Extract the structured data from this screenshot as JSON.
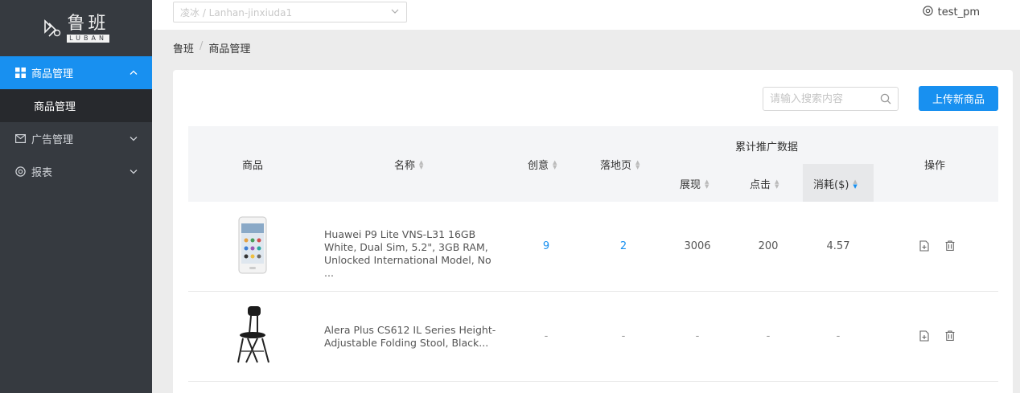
{
  "sidebar": {
    "logo_cn": "鲁班",
    "logo_en": "LUBAN",
    "menu": [
      {
        "label": "商品管理",
        "icon": "grid-icon",
        "expanded": true
      },
      {
        "label": "广告管理",
        "icon": "mail-icon",
        "expanded": false
      },
      {
        "label": "报表",
        "icon": "settings-icon",
        "expanded": false
      }
    ],
    "submenu": [
      {
        "label": "商品管理"
      }
    ]
  },
  "topbar": {
    "project_select": "凌冰 / Lanhan-jinxiuda1",
    "user": "test_pm"
  },
  "breadcrumb": [
    "鲁班",
    "商品管理"
  ],
  "toolbar": {
    "search_placeholder": "请输入搜索内容",
    "upload_label": "上传新商品"
  },
  "table": {
    "headers": {
      "product": "商品",
      "name": "名称",
      "creative": "创意",
      "landing": "落地页",
      "group": "累计推广数据",
      "impressions": "展现",
      "clicks": "点击",
      "cost": "消耗($)",
      "actions": "操作"
    },
    "rows": [
      {
        "image": "phone",
        "name": "Huawei P9 Lite VNS-L31 16GB White, Dual Sim, 5.2\", 3GB RAM, Unlocked International Model, No ...",
        "creative": "9",
        "landing": "2",
        "impressions": "3006",
        "clicks": "200",
        "cost": "4.57"
      },
      {
        "image": "stool",
        "name": "Alera Plus CS612 IL Series Height-Adjustable Folding Stool, Black...",
        "creative": "-",
        "landing": "-",
        "impressions": "-",
        "clicks": "-",
        "cost": "-"
      }
    ]
  },
  "colors": {
    "accent": "#1890f0",
    "sidebar_bg": "#363a40",
    "submenu_bg": "#27292d"
  }
}
